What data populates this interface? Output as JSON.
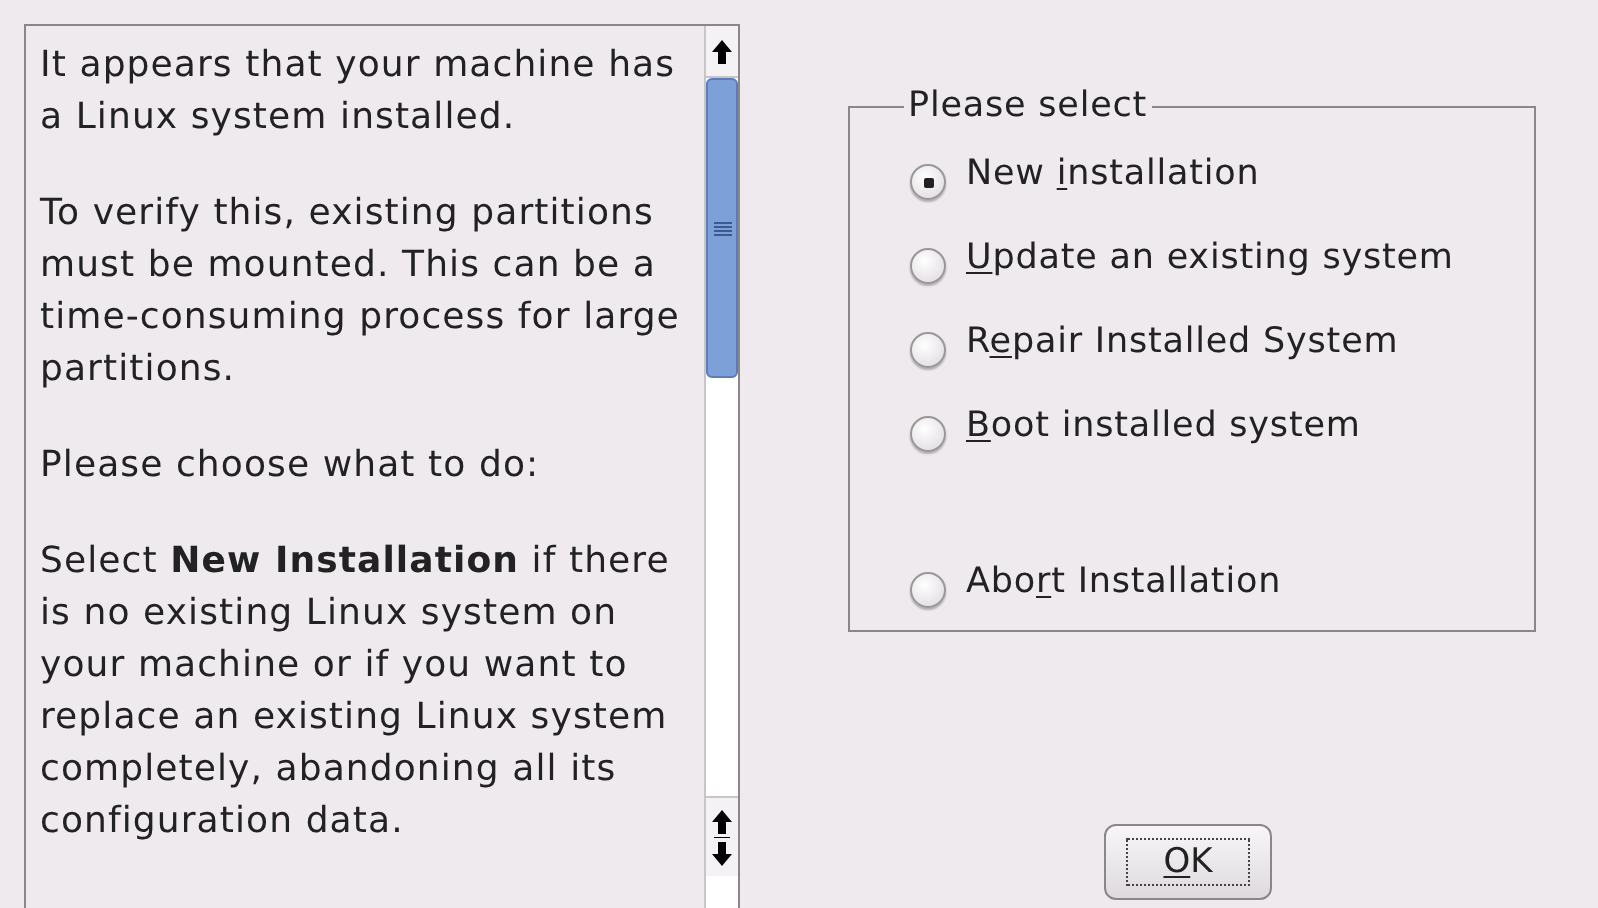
{
  "info_panel": {
    "paragraphs": [
      "It appears that your machine has a Linux system installed.",
      "To verify this, existing partitions must be mounted. This can be a time-consuming process for large partitions.",
      "Please choose what to do:",
      "Select **New Installation** if there is no existing Linux system on your machine or if you want to replace an existing Linux system completely, abandoning all its configuration data."
    ]
  },
  "options_group": {
    "title": "Please select",
    "options": [
      {
        "label": {
          "before": "New ",
          "key": "i",
          "after": "nstallation"
        },
        "selected": true,
        "gap_before": false
      },
      {
        "label": {
          "key": "U",
          "after": "pdate an existing system"
        },
        "selected": false,
        "gap_before": false
      },
      {
        "label": {
          "before": "R",
          "key": "e",
          "after": "pair Installed System"
        },
        "selected": false,
        "gap_before": false
      },
      {
        "label": {
          "key": "B",
          "after": "oot installed system"
        },
        "selected": false,
        "gap_before": false
      },
      {
        "label": {
          "before": "Abo",
          "key": "r",
          "after": "t Installation"
        },
        "selected": false,
        "gap_before": true
      }
    ]
  },
  "ok_button": {
    "label": {
      "key": "O",
      "after": "K"
    }
  }
}
